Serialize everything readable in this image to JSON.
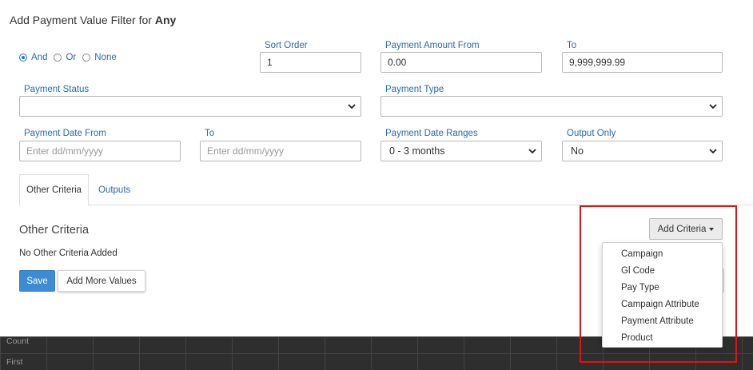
{
  "dialog": {
    "title_prefix": "Add Payment Value Filter for",
    "title_target": "Any"
  },
  "logic": {
    "options": [
      "And",
      "Or",
      "None"
    ],
    "selected": "And"
  },
  "fields": {
    "sort_order": {
      "label": "Sort Order",
      "value": "1"
    },
    "amount_from": {
      "label": "Payment Amount From",
      "value": "0.00"
    },
    "amount_to": {
      "label": "To",
      "value": "9,999,999.99"
    },
    "payment_status": {
      "label": "Payment Status",
      "value": ""
    },
    "payment_type": {
      "label": "Payment Type",
      "value": ""
    },
    "date_from": {
      "label": "Payment Date From",
      "placeholder": "Enter dd/mm/yyyy"
    },
    "date_to": {
      "label": "To",
      "placeholder": "Enter dd/mm/yyyy"
    },
    "date_ranges": {
      "label": "Payment Date Ranges",
      "value": "0 - 3 months"
    },
    "output_only": {
      "label": "Output Only",
      "value": "No"
    }
  },
  "tabs": [
    {
      "label": "Other Criteria",
      "active": true
    },
    {
      "label": "Outputs",
      "active": false
    }
  ],
  "criteria_section": {
    "title": "Other Criteria",
    "empty_text": "No Other Criteria Added",
    "add_button": "Add Criteria",
    "menu_items": [
      "Campaign",
      "Gl Code",
      "Pay Type",
      "Campaign Attribute",
      "Payment Attribute",
      "Product"
    ]
  },
  "actions": {
    "save": "Save",
    "add_more": "Add More Values"
  },
  "background_grid": {
    "row_labels": [
      "Count",
      "First"
    ]
  },
  "colors": {
    "accent_blue": "#3f8bd1",
    "label_blue": "#2a6bb0",
    "highlight_red": "#e01313"
  }
}
